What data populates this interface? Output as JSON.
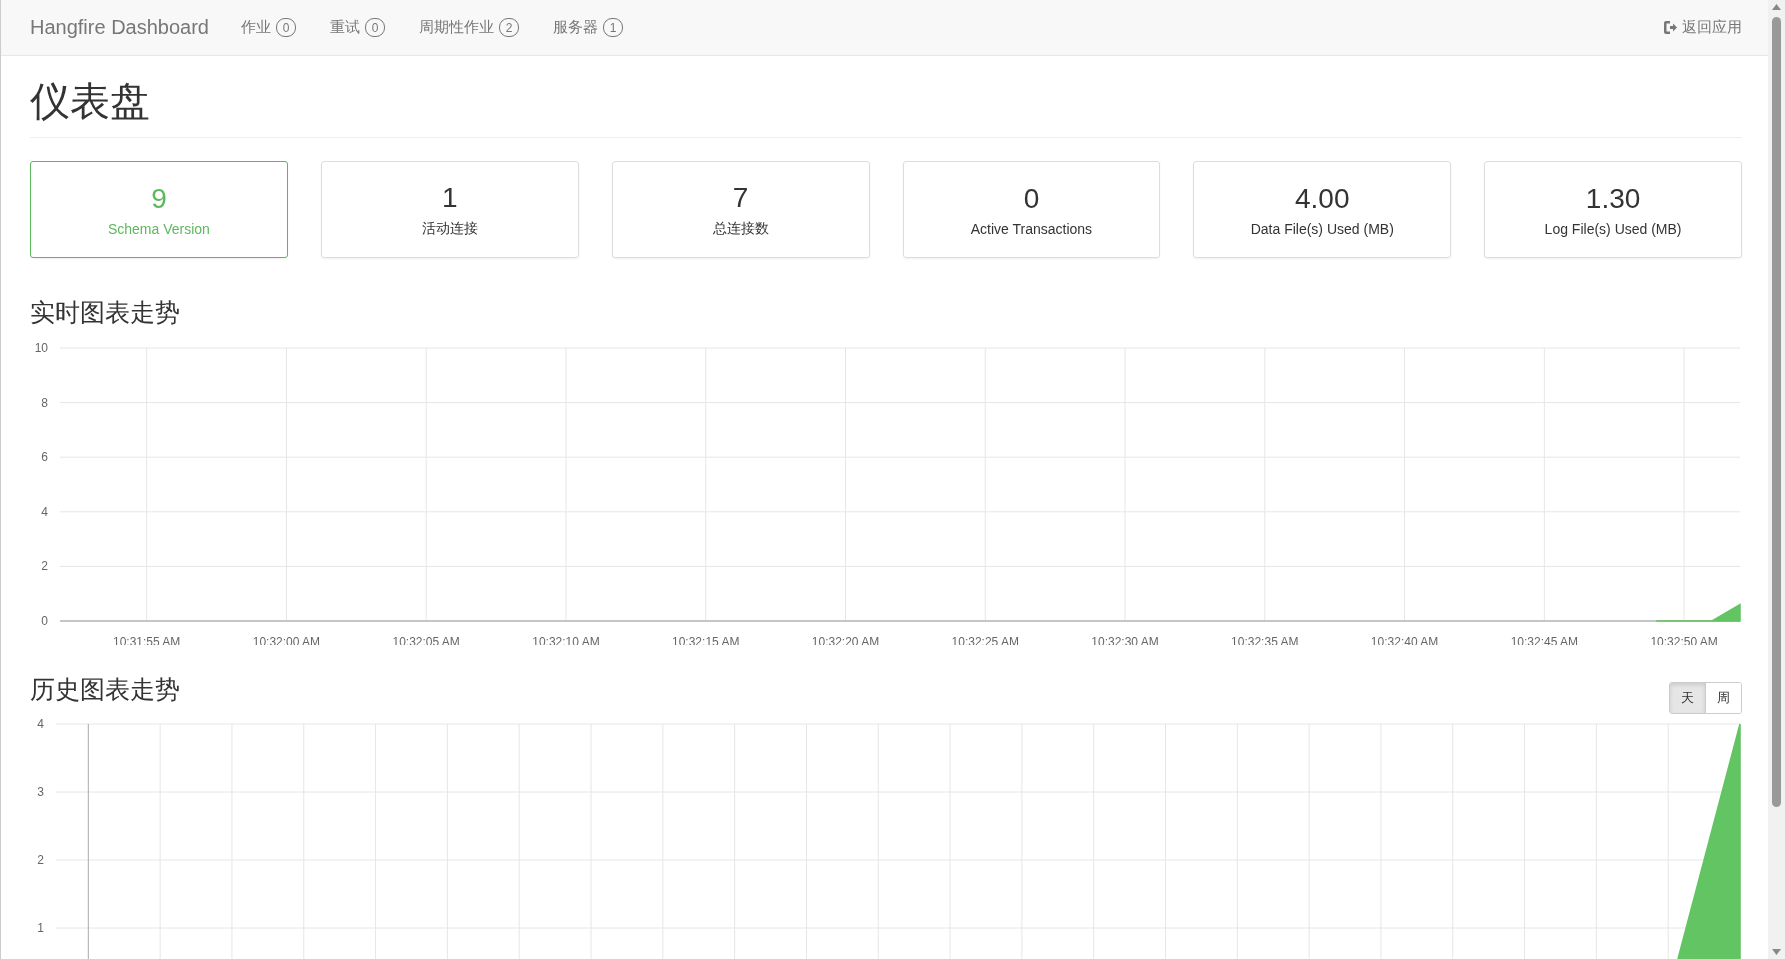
{
  "nav": {
    "brand": "Hangfire Dashboard",
    "items": [
      {
        "label": "作业",
        "count": "0"
      },
      {
        "label": "重试",
        "count": "0"
      },
      {
        "label": "周期性作业",
        "count": "2"
      },
      {
        "label": "服务器",
        "count": "1"
      }
    ],
    "back_link": "返回应用"
  },
  "page_title": "仪表盘",
  "metrics": [
    {
      "value": "9",
      "label": "Schema Version",
      "highlighted": true
    },
    {
      "value": "1",
      "label": "活动连接",
      "highlighted": false
    },
    {
      "value": "7",
      "label": "总连接数",
      "highlighted": false
    },
    {
      "value": "0",
      "label": "Active Transactions",
      "highlighted": false
    },
    {
      "value": "4.00",
      "label": "Data File(s) Used (MB)",
      "highlighted": false
    },
    {
      "value": "1.30",
      "label": "Log File(s) Used (MB)",
      "highlighted": false
    }
  ],
  "realtime": {
    "title": "实时图表走势",
    "chart_data": {
      "type": "area",
      "grid": true,
      "ylim": [
        0,
        10
      ],
      "yticks": [
        0,
        2,
        4,
        6,
        8,
        10
      ],
      "categories": [
        null,
        null,
        null,
        "10:31:55 AM",
        null,
        null,
        null,
        null,
        "10:32:00 AM",
        null,
        null,
        null,
        null,
        "10:32:05 AM",
        null,
        null,
        null,
        null,
        "10:32:10 AM",
        null,
        null,
        null,
        null,
        "10:32:15 AM",
        null,
        null,
        null,
        null,
        "10:32:20 AM",
        null,
        null,
        null,
        null,
        "10:32:25 AM",
        null,
        null,
        null,
        null,
        "10:32:30 AM",
        null,
        null,
        null,
        null,
        "10:32:35 AM",
        null,
        null,
        null,
        null,
        "10:32:40 AM",
        null,
        null,
        null,
        null,
        "10:32:45 AM",
        null,
        null,
        null,
        null,
        "10:32:50 AM",
        null,
        null
      ],
      "series": [
        {
          "color": "#62c462",
          "values": [
            null,
            null,
            null,
            null,
            null,
            null,
            null,
            null,
            null,
            null,
            null,
            null,
            null,
            null,
            null,
            null,
            null,
            null,
            null,
            null,
            null,
            null,
            null,
            null,
            null,
            null,
            null,
            null,
            null,
            null,
            null,
            null,
            null,
            null,
            null,
            null,
            null,
            null,
            null,
            null,
            null,
            null,
            null,
            null,
            null,
            null,
            null,
            null,
            null,
            null,
            null,
            null,
            null,
            null,
            null,
            null,
            null,
            0,
            0,
            0,
            0.6
          ]
        }
      ]
    }
  },
  "history": {
    "title": "历史图表走势",
    "periods": [
      {
        "label": "天",
        "selected": true
      },
      {
        "label": "周",
        "selected": false
      }
    ],
    "chart_data": {
      "type": "area",
      "categories": [
        null,
        null,
        null,
        null,
        null,
        null,
        null,
        null,
        null,
        null,
        null,
        null,
        null,
        null,
        null,
        null,
        null,
        null,
        null,
        null,
        null,
        null,
        null,
        null
      ],
      "grid": true,
      "ylim": [
        0,
        4
      ],
      "yticks": [
        1,
        2,
        3,
        4
      ],
      "series": [
        {
          "color": "#62c462",
          "values": [
            0,
            0,
            0,
            0,
            0,
            0,
            0,
            0,
            0,
            0,
            0,
            0,
            0,
            0,
            0,
            0,
            0,
            0,
            0,
            0,
            0,
            0,
            0,
            4
          ]
        }
      ]
    }
  }
}
